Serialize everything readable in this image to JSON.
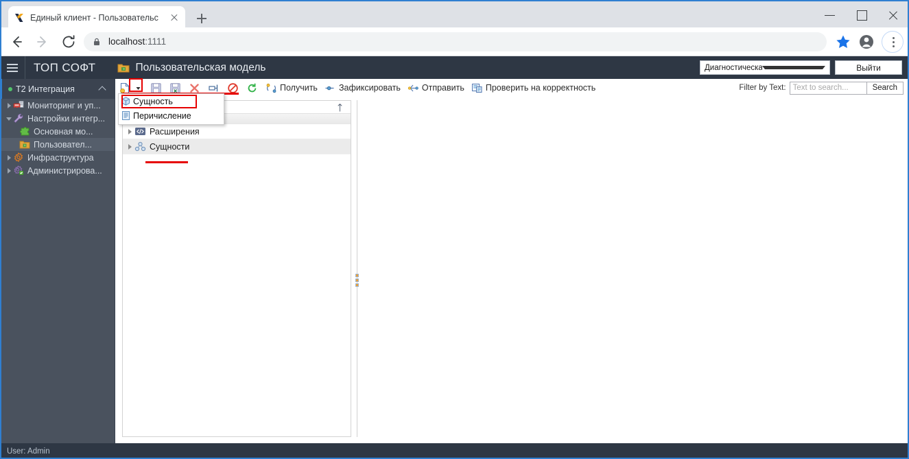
{
  "browser": {
    "tab": {
      "title": "Единый клиент - Пользовательс",
      "favicon": "x-logo-icon"
    },
    "newtab_label": "+",
    "address": {
      "host": "localhost",
      "port": ":1111",
      "full": "localhost:1111"
    },
    "window_controls": {
      "minimize": "minimize-icon",
      "maximize": "maximize-icon",
      "close": "close-icon"
    }
  },
  "app_header": {
    "menu_icon": "hamburger-icon",
    "brand": "ТОП СОФТ",
    "page_icon": "folder-model-icon",
    "page_title": "Пользовательская модель",
    "diagnostics_select": "Диагностическая информация",
    "logout_label": "Выйти"
  },
  "sidebar": {
    "header": {
      "label": "T2 Интеграция",
      "status_color": "#51c26a"
    },
    "items": [
      {
        "label": "Мониторинг и уп...",
        "icon": "monitor-icon",
        "state": "collapsed",
        "level": 1,
        "selected": false
      },
      {
        "label": "Настройки интегр...",
        "icon": "wrench-icon",
        "state": "expanded",
        "level": 1,
        "selected": false
      },
      {
        "label": "Основная мо...",
        "icon": "puzzle-icon",
        "state": "leaf",
        "level": 2,
        "selected": false
      },
      {
        "label": "Пользовател...",
        "icon": "folder-model-icon",
        "state": "leaf",
        "level": 2,
        "selected": true
      },
      {
        "label": "Инфраструктура",
        "icon": "gear-orange-icon",
        "state": "collapsed",
        "level": 1,
        "selected": false
      },
      {
        "label": "Администрирова...",
        "icon": "gear-admin-icon",
        "state": "collapsed",
        "level": 1,
        "selected": false
      }
    ]
  },
  "toolbar": {
    "icon_buttons": [
      {
        "name": "new-document-icon"
      },
      {
        "name": "dropdown-caret-icon"
      },
      {
        "name": "save-icon"
      },
      {
        "name": "save-as-icon"
      },
      {
        "name": "delete-icon"
      },
      {
        "name": "rename-icon"
      },
      {
        "name": "block-icon"
      },
      {
        "name": "refresh-icon"
      }
    ],
    "text_buttons": [
      {
        "label": "Получить",
        "icon": "fetch-icon"
      },
      {
        "label": "Зафиксировать",
        "icon": "commit-icon"
      },
      {
        "label": "Отправить",
        "icon": "send-icon"
      },
      {
        "label": "Проверить на корректность",
        "icon": "validate-icon"
      }
    ],
    "filter_label": "Filter by Text:",
    "filter_placeholder": "Text to search...",
    "search_label": "Search"
  },
  "dropdown_menu": {
    "items": [
      {
        "label": "Сущность",
        "icon": "entity-cube-icon",
        "highlighted": true
      },
      {
        "label": "Перичисление",
        "icon": "enum-list-icon",
        "highlighted": false
      }
    ]
  },
  "tree_panel": {
    "sort_indicator": "sort-asc-icon",
    "rows": [
      {
        "label": "Расширения",
        "icon": "code-brackets-icon",
        "expandable": true,
        "selected": false
      },
      {
        "label": "Сущности",
        "icon": "entities-nodes-icon",
        "expandable": true,
        "selected": true
      }
    ]
  },
  "status_bar": {
    "text": "User: Admin"
  },
  "accent_colors": {
    "window_border": "#2f7fd1",
    "annotation_red": "#e60000",
    "header_bg": "#2e3744",
    "sidebar_bg": "#4a525e",
    "chrome_blue": "#1a73e8"
  }
}
